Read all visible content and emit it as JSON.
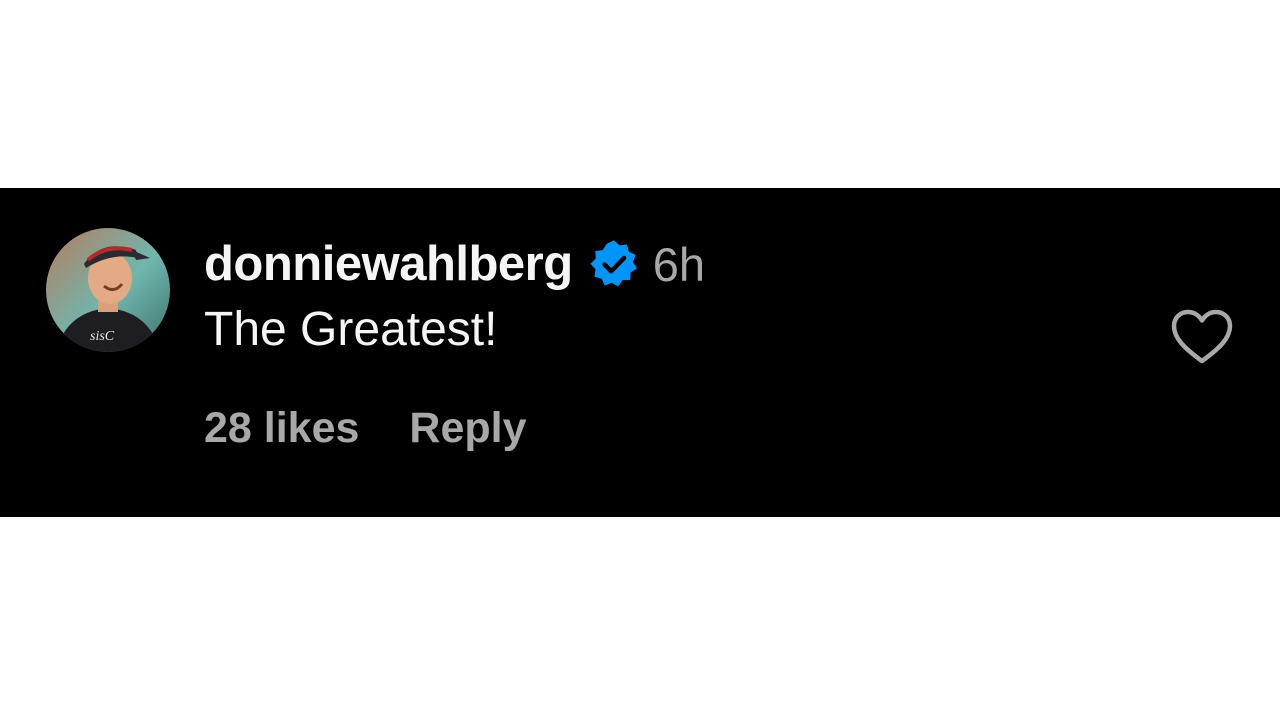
{
  "comment": {
    "avatar_icon": "profile-photo-avatar",
    "username": "donniewahlberg",
    "verified_icon": "verified-badge-icon",
    "verified_color": "#0095f6",
    "timestamp": "6h",
    "text": "The Greatest!",
    "likes_label": "28 likes",
    "reply_label": "Reply",
    "like_icon": "heart-outline-icon"
  },
  "colors": {
    "panel_background": "#000000",
    "page_background": "#ffffff",
    "primary_text": "#f5f5f5",
    "secondary_text": "#a8a8a8"
  }
}
